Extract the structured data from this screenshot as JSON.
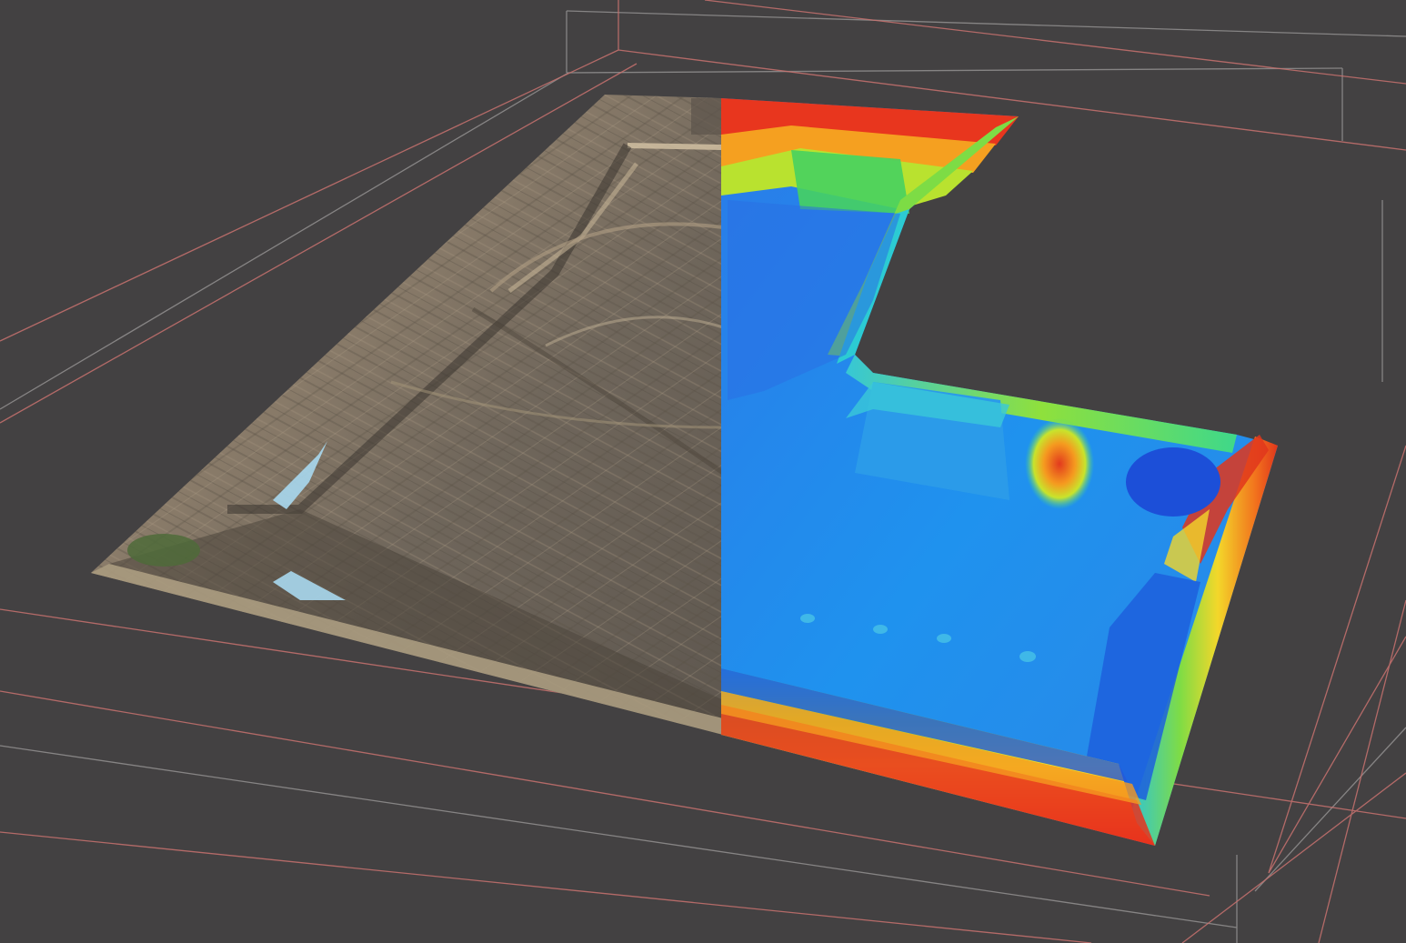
{
  "viewport": {
    "background_color": "#434142",
    "bounding_box_colors": {
      "primary": "#c8726f",
      "secondary": "#8e8c8c"
    }
  },
  "model": {
    "left_half_texture": "aerial-photo-dirt-construction-site",
    "right_half_texture": "elevation-heatmap",
    "elevation_colormap": [
      "#1c4fd8",
      "#1f8ef0",
      "#27c4e0",
      "#3fd88a",
      "#9be23a",
      "#f2e62a",
      "#f59a1f",
      "#e7331d"
    ],
    "photo_palette": [
      "#6e6356",
      "#857868",
      "#9b8b76",
      "#5c544b",
      "#b3a38a"
    ],
    "water_color": "#a9d8ee",
    "vegetation_color": "#4f6b3a"
  }
}
